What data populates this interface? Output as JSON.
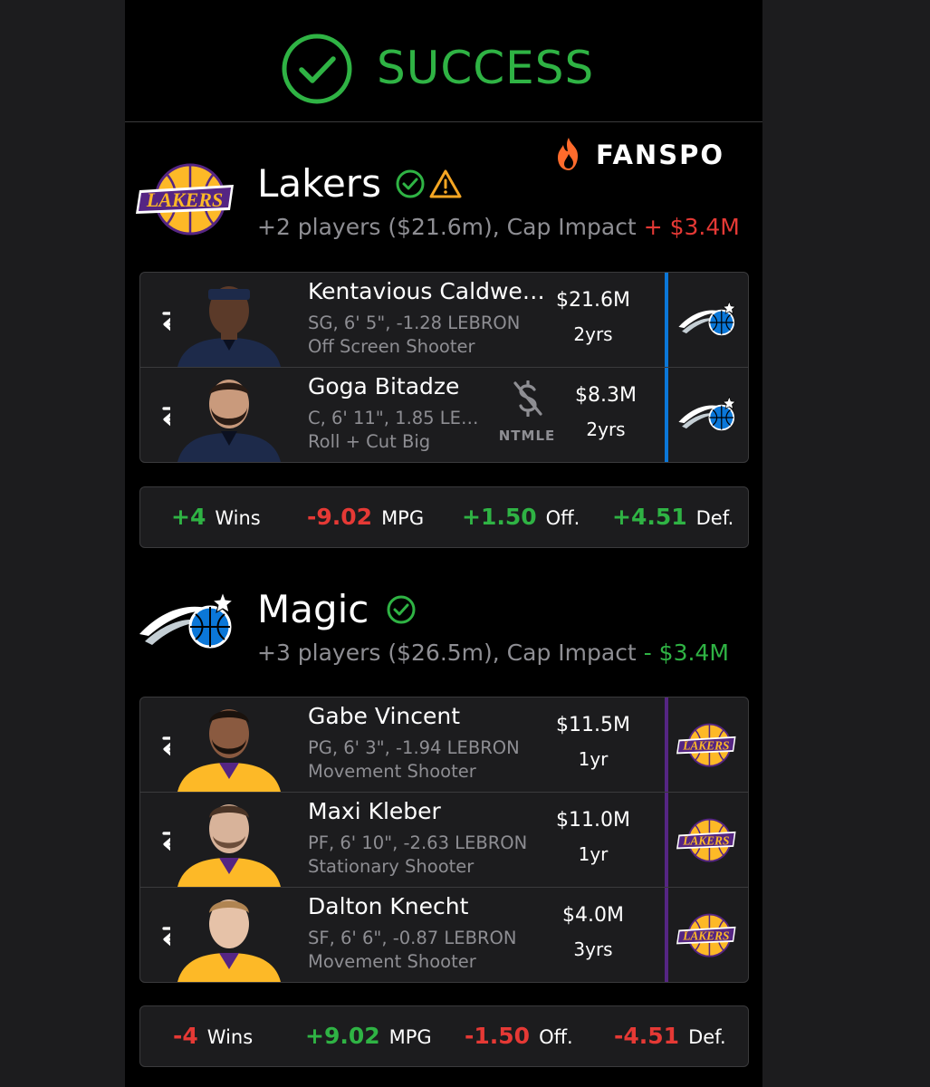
{
  "status": {
    "text": "SUCCESS",
    "color": "#2fb344"
  },
  "brand": {
    "name": "FANSPO"
  },
  "teams": [
    {
      "name": "Lakers",
      "badges": [
        "check-circle-icon",
        "warning-icon"
      ],
      "summary": "+2 players ($21.6m), Cap Impact",
      "impact": "+ $3.4M",
      "players": [
        {
          "name": "Kentavious Caldwe…",
          "meta": "SG, 6' 5\", -1.28 LEBRON",
          "role": "Off Screen Shooter",
          "salary": "$21.6M",
          "years": "2yrs",
          "from_team": "magic"
        },
        {
          "name": "Goga Bitadze",
          "meta": "C, 6' 11\", 1.85 LE…",
          "role": "Roll + Cut Big",
          "salary": "$8.3M",
          "years": "2yrs",
          "tag": "NTMLE",
          "from_team": "magic"
        }
      ],
      "stats": {
        "wins": "+4",
        "wins_label": "Wins",
        "mpg": "-9.02",
        "mpg_label": "MPG",
        "off": "+1.50",
        "off_label": "Off.",
        "def": "+4.51",
        "def_label": "Def."
      }
    },
    {
      "name": "Magic",
      "badges": [
        "check-circle-icon"
      ],
      "summary": "+3 players ($26.5m), Cap Impact",
      "impact": "- $3.4M",
      "players": [
        {
          "name": "Gabe Vincent",
          "meta": "PG, 6' 3\", -1.94 LEBRON",
          "role": "Movement Shooter",
          "salary": "$11.5M",
          "years": "1yr",
          "from_team": "lakers"
        },
        {
          "name": "Maxi Kleber",
          "meta": "PF, 6' 10\", -2.63 LEBRON",
          "role": "Stationary Shooter",
          "salary": "$11.0M",
          "years": "1yr",
          "from_team": "lakers"
        },
        {
          "name": "Dalton Knecht",
          "meta": "SF, 6' 6\", -0.87 LEBRON",
          "role": "Movement Shooter",
          "salary": "$4.0M",
          "years": "3yrs",
          "from_team": "lakers"
        }
      ],
      "stats": {
        "wins": "-4",
        "wins_label": "Wins",
        "mpg": "+9.02",
        "mpg_label": "MPG",
        "off": "-1.50",
        "off_label": "Off.",
        "def": "-4.51",
        "def_label": "Def."
      }
    }
  ],
  "colors": {
    "positive": "#2fb344",
    "negative": "#e53935",
    "magic_accent": "#0b77d8",
    "lakers_accent": "#552583",
    "lakers_gold": "#fdb927"
  }
}
